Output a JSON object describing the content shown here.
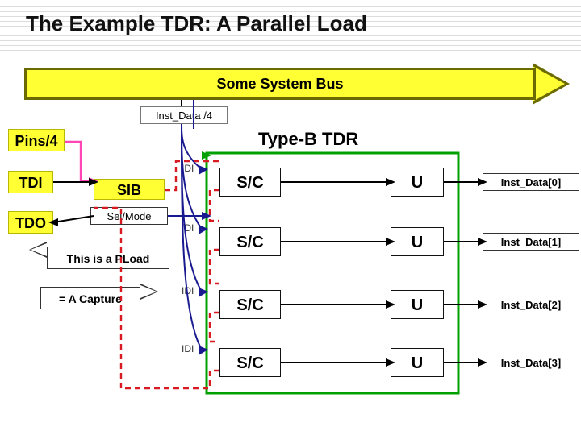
{
  "title": "The Example TDR: A Parallel Load",
  "bus_label": "Some System Bus",
  "inst_data_label": "Inst_Data /4",
  "pins_label": "Pins/4",
  "tdi_label": "TDI",
  "tdo_label": "TDO",
  "tdr_type_label": "Type-B TDR",
  "sib_label": "SIB",
  "selmode_label": "Sel/Mode",
  "pload_label": "This is a PLoad",
  "capture_label": "= A Capture",
  "rows": [
    {
      "idi": "IDI",
      "sc": "S/C",
      "u": "U",
      "id": "Inst_Data[0]"
    },
    {
      "idi": "IDI",
      "sc": "S/C",
      "u": "U",
      "id": "Inst_Data[1]"
    },
    {
      "idi": "IDI",
      "sc": "S/C",
      "u": "U",
      "id": "Inst_Data[2]"
    },
    {
      "idi": "IDI",
      "sc": "S/C",
      "u": "U",
      "id": "Inst_Data[3]"
    }
  ],
  "chart_data": {
    "type": "diagram",
    "title": "The Example TDR: A Parallel Load",
    "entities": {
      "bus": {
        "name": "Some System Bus",
        "width": 4,
        "signal": "Inst_Data /4"
      },
      "external_pins": "Pins/4",
      "serial_in": "TDI",
      "serial_out": "TDO",
      "sib": {
        "label": "SIB",
        "control": "Sel/Mode"
      },
      "tdr_type": "Type-B TDR",
      "cells": [
        {
          "shift_capture": "S/C",
          "update": "U",
          "bit": "Inst_Data[0]",
          "parallel_in": "IDI"
        },
        {
          "shift_capture": "S/C",
          "update": "U",
          "bit": "Inst_Data[1]",
          "parallel_in": "IDI"
        },
        {
          "shift_capture": "S/C",
          "update": "U",
          "bit": "Inst_Data[2]",
          "parallel_in": "IDI"
        },
        {
          "shift_capture": "S/C",
          "update": "U",
          "bit": "Inst_Data[3]",
          "parallel_in": "IDI"
        }
      ]
    },
    "relations": [
      "Inst_Data[0..3] fan out from Some System Bus (parallel load) into each IDI",
      "Red dashed loop: serial scan path TDI → SIB → S/C chain → back to SIB → TDO",
      "PLoad operation = A Capture",
      "Pink arrow: Pins/4 connects to SIB",
      "Dark-blue arrow: SIB Sel/Mode feeds the TDR region",
      "Green frame groups the four {S/C,U} cells as the Type-B TDR"
    ]
  }
}
